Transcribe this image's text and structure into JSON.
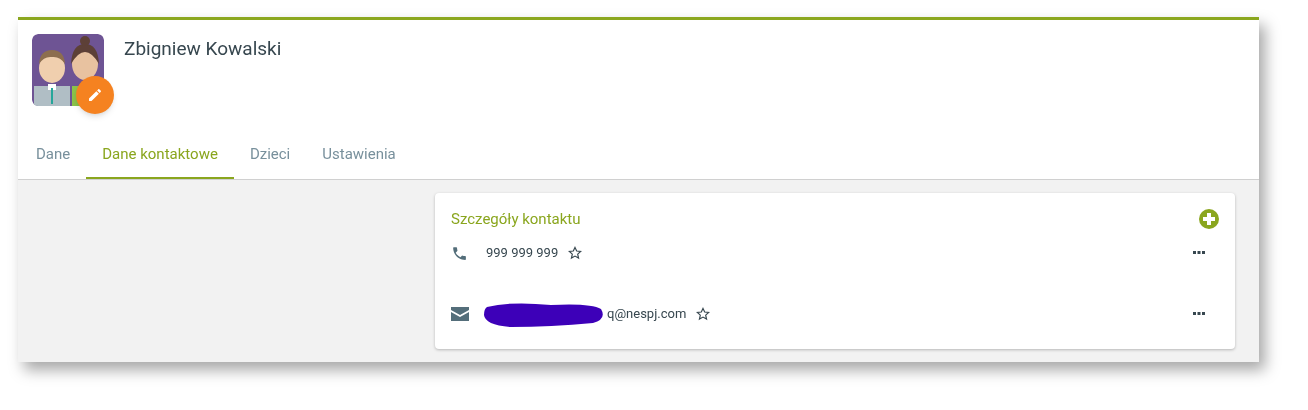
{
  "profile": {
    "name": "Zbigniew Kowalski"
  },
  "tabs": [
    {
      "label": "Dane",
      "selected": false
    },
    {
      "label": "Dane kontaktowe",
      "selected": true
    },
    {
      "label": "Dzieci",
      "selected": false
    },
    {
      "label": "Ustawienia",
      "selected": false
    }
  ],
  "contact_card": {
    "title": "Szczegóły kontaktu",
    "items": [
      {
        "kind": "phone",
        "value": "999 999 999",
        "redacted": false
      },
      {
        "kind": "email",
        "value": "q@nespj.com",
        "redacted": true
      }
    ]
  }
}
